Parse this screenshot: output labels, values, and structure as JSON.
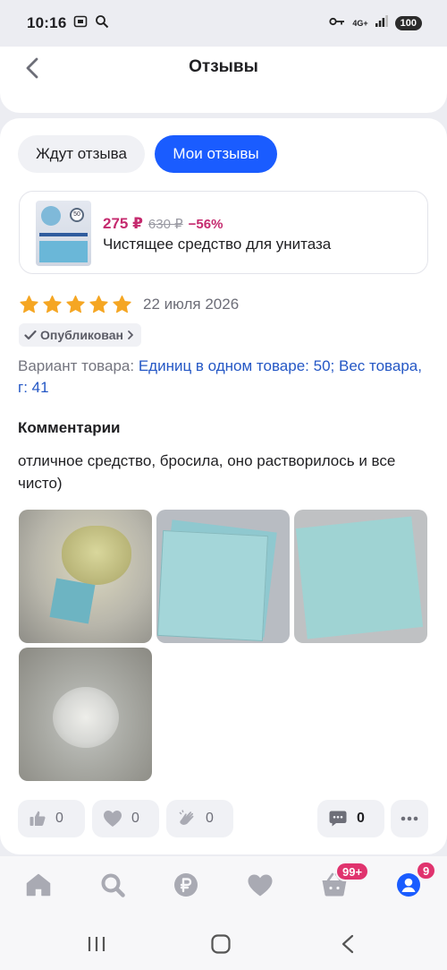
{
  "status_bar": {
    "time": "10:16",
    "network": "4G+",
    "battery": "100"
  },
  "header": {
    "title": "Отзывы"
  },
  "tabs": [
    {
      "label": "Ждут отзыва",
      "active": false
    },
    {
      "label": "Мои отзывы",
      "active": true
    }
  ],
  "product": {
    "price_new": "275 ₽",
    "price_old": "630 ₽",
    "discount": "−56%",
    "name": "Чистящее средство для унитаза",
    "thumb_badge": "50"
  },
  "review": {
    "rating": 5,
    "date": "22 июля 2026",
    "status": "Опубликован",
    "variant_label": "Вариант товара:",
    "variant_value": "Единиц в одном товаре: 50; Вес товара, г: 41",
    "comments_title": "Комментарии",
    "comment": "отличное средство, бросила, оно растворилось и все чисто)"
  },
  "actions": {
    "likes": "0",
    "hearts": "0",
    "claps": "0",
    "comments": "0"
  },
  "bottom_nav": {
    "cart_badge": "99+",
    "profile_badge": "9"
  },
  "colors": {
    "accent": "#1a5cff",
    "price": "#c52a6e",
    "star": "#f5a623",
    "badge": "#e0336e",
    "link": "#2457c5"
  }
}
